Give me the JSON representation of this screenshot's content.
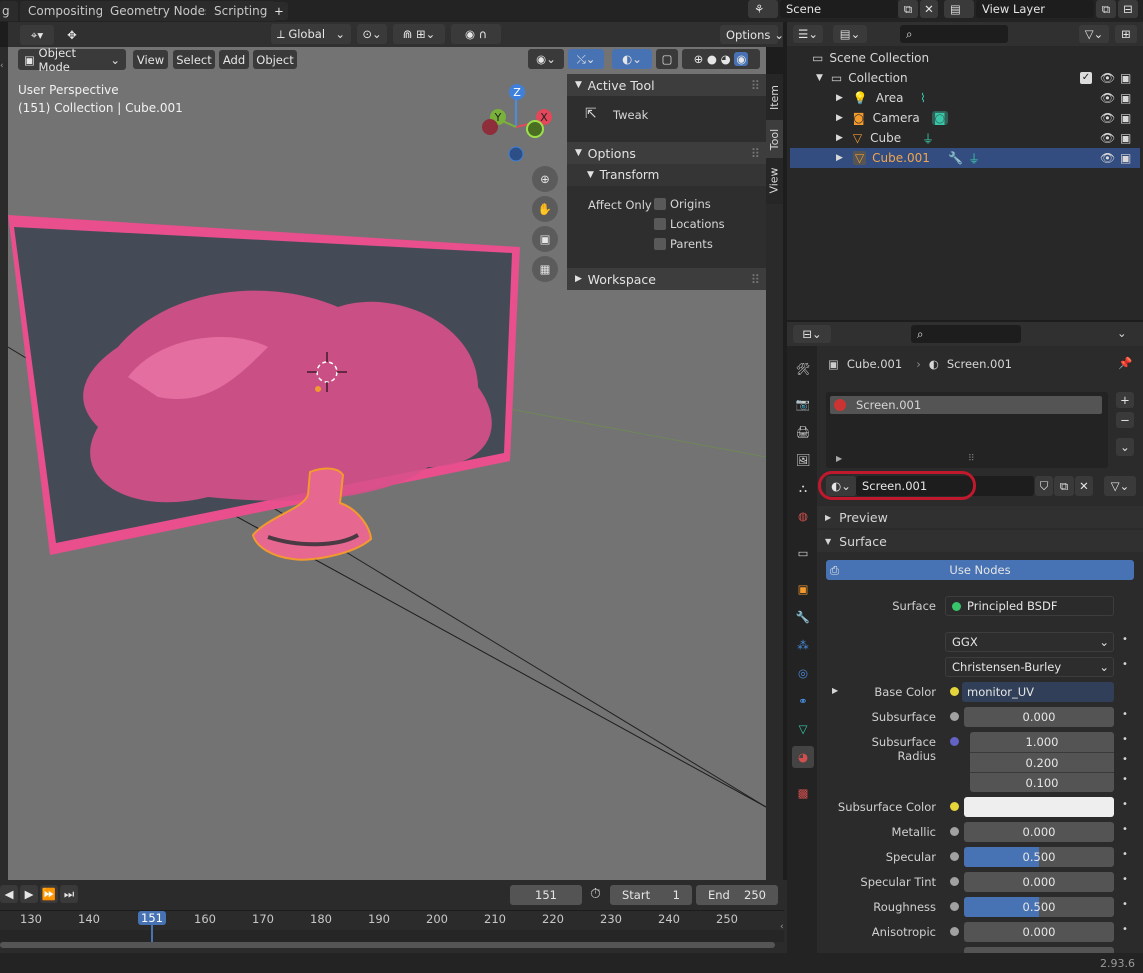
{
  "topbar": {
    "tabs": [
      "g",
      "Compositing",
      "Geometry Nodes",
      "Scripting"
    ],
    "add_tab": "+",
    "scene": "Scene",
    "view_layer": "View Layer"
  },
  "viewport": {
    "mode": "Object Mode",
    "menus": [
      "View",
      "Select",
      "Add",
      "Object"
    ],
    "orientation": "Global",
    "options": "Options",
    "overlay_title": "User Perspective",
    "overlay_sub": "(151) Collection | Cube.001",
    "gizmo_axes": {
      "z": "Z",
      "y": "Y",
      "x": "X"
    },
    "side_tabs": [
      "Item",
      "Tool",
      "View"
    ]
  },
  "npanel": {
    "active_tool": "Active Tool",
    "tool_name": "Tweak",
    "options": "Options",
    "transform": "Transform",
    "affect_only": "Affect Only",
    "checks": [
      "Origins",
      "Locations",
      "Parents"
    ],
    "workspace": "Workspace"
  },
  "outliner": {
    "root": "Scene Collection",
    "collection": "Collection",
    "items": [
      "Area",
      "Camera",
      "Cube",
      "Cube.001"
    ]
  },
  "properties": {
    "breadcrumb_object": "Cube.001",
    "breadcrumb_material": "Screen.001",
    "slot": "Screen.001",
    "material_name": "Screen.001",
    "preview": "Preview",
    "surface_section": "Surface",
    "use_nodes": "Use Nodes",
    "surface_label": "Surface",
    "surface_value": "Principled BSDF",
    "distribution": "GGX",
    "subsurface_method": "Christensen-Burley",
    "rows": [
      {
        "label": "Base Color",
        "value": "monitor_UV"
      },
      {
        "label": "Subsurface",
        "value": "0.000"
      },
      {
        "label": "Subsurface Radius",
        "value": "1.000"
      },
      {
        "label": "",
        "value": "0.200"
      },
      {
        "label": "",
        "value": "0.100"
      },
      {
        "label": "Subsurface Color",
        "value": ""
      },
      {
        "label": "Metallic",
        "value": "0.000"
      },
      {
        "label": "Specular",
        "value": "0.500"
      },
      {
        "label": "Specular Tint",
        "value": "0.000"
      },
      {
        "label": "Roughness",
        "value": "0.500"
      },
      {
        "label": "Anisotropic",
        "value": "0.000"
      }
    ],
    "specular_fill": 0.5,
    "roughness_fill": 0.5
  },
  "timeline": {
    "current_frame": "151",
    "start_label": "Start",
    "start": "1",
    "end_label": "End",
    "end": "250",
    "ticks": [
      "130",
      "140",
      "151",
      "160",
      "170",
      "180",
      "190",
      "200",
      "210",
      "220",
      "230",
      "240",
      "250"
    ]
  },
  "status": {
    "version": "2.93.6"
  },
  "colors": {
    "accent": "#4772b3",
    "selected_row": "#334d80",
    "magenta": "#e84f8c",
    "highlight_ring": "#c0182c"
  }
}
